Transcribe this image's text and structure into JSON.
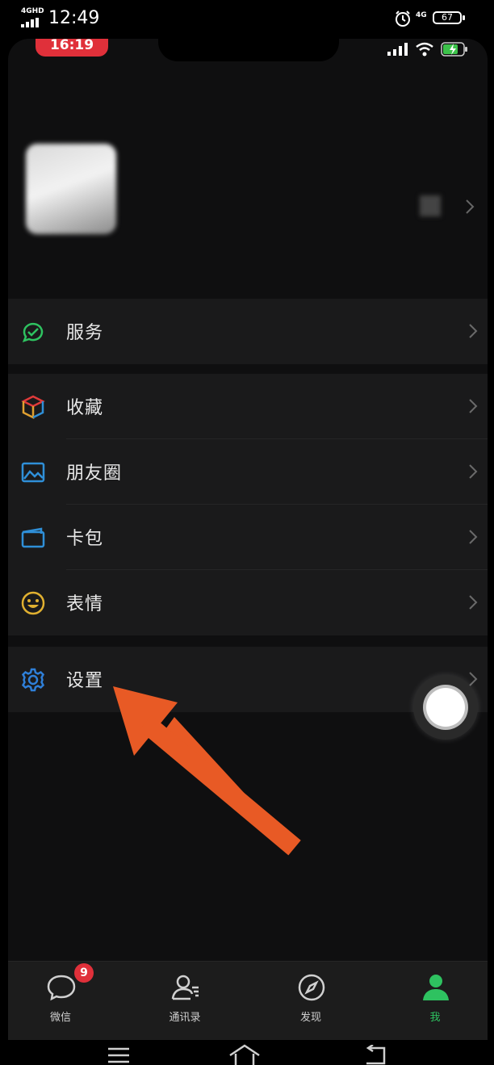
{
  "outer_status": {
    "network": "4GHD",
    "time": "12:49",
    "network_right": "4G",
    "battery": "67"
  },
  "inner_status": {
    "time": "16:19"
  },
  "profile": {
    "nickname": "",
    "wechat_id": "",
    "status": ""
  },
  "menu": {
    "services": {
      "label": "服务",
      "icon": "services-icon",
      "color": "#2ec260"
    },
    "favorites": {
      "label": "收藏",
      "icon": "favorites-cube-icon",
      "color": "#e0a030"
    },
    "moments": {
      "label": "朋友圈",
      "icon": "moments-image-icon",
      "color": "#2f8fd8"
    },
    "cards": {
      "label": "卡包",
      "icon": "card-wallet-icon",
      "color": "#2f8fd8"
    },
    "stickers": {
      "label": "表情",
      "icon": "sticker-smiley-icon",
      "color": "#e0b030"
    },
    "settings": {
      "label": "设置",
      "icon": "gear-icon",
      "color": "#2f7fd8"
    }
  },
  "tabs": [
    {
      "label": "微信",
      "badge": "9",
      "icon": "chat-bubble-icon"
    },
    {
      "label": "通讯录",
      "icon": "contacts-icon"
    },
    {
      "label": "发现",
      "icon": "compass-icon"
    },
    {
      "label": "我",
      "icon": "person-icon",
      "active": true
    }
  ],
  "colors": {
    "accent_green": "#2ec260",
    "badge_red": "#e0303a",
    "arrow_orange": "#e85a25"
  }
}
